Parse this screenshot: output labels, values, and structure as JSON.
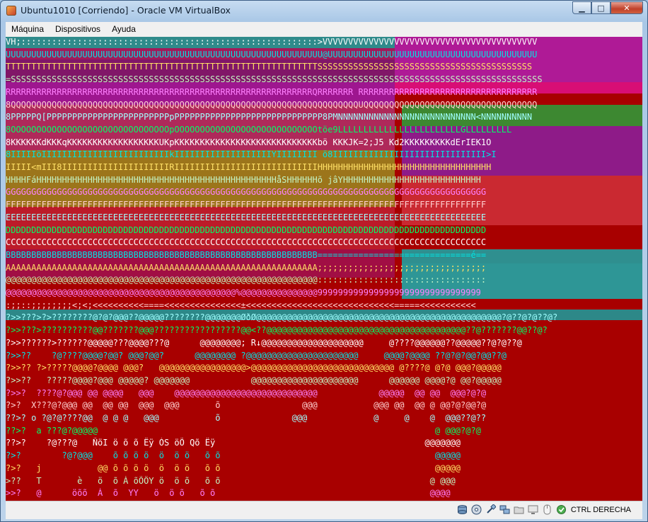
{
  "window": {
    "title": "Ubuntu1010 [Corriendo] - Oracle VM VirtualBox",
    "minimize_glyph": "▁",
    "maximize_glyph": "□",
    "close_glyph": "✕"
  },
  "menu": {
    "items": [
      "Máquina",
      "Dispositivos",
      "Ayuda"
    ]
  },
  "screen": {
    "background": "#a80000",
    "rows": [
      "VH;::::::::::::::::::::::::::::::::::::::::::::::::::::::::::>VVVVVVVVVVVVVVVVVVVVVVVVVVVVVVVVVVVVVVVVVV",
      "UUUUUUUUUUUUUUUUUUUUUUUUUUUUUUUUUUUUUUUUUUUUUUUUUUUUUUUUUUUUUU@UUUUUUUUUUUUUUUUUUUUUUUUUUUUUUUUUUUUUUUUU",
      "TTTTTTTTTTTTTTTTTTTTTTTTTTTTTTTTTTTTTTTTTTTTTTTTTTTTTTTTTTTTTSSSSSSSSSSSSSSSSSSSSSSSSSSSSSSSSSSSSSSSSSS",
      "=SSSSSSSSSSSSSSSSSSSSSSSSSSSSSSSSSSSSSSSSSSSSSSSSSSSSSSSSSSSSSSSSSSSSSSSSSSSSSSSSSSSSSSSSSSSSSSSSSSSSSSSS",
      "RRRRRRRRRRRRRRRRRRRRRRRRRRRRRRRRRRRRRRRRRRRRRRRRRRRRRRRRRRRRQRRRRRRR RRRRRRRRRRRRRRRRRRRRRRRRRRRRRRRRRRR",
      "8QQQQQQQQQQQQQQQQQQQQQQQQQQQQQQQQQQQQQQQQQQQQQQQQQQQQQQQQQQQQQQQQQQQQUQQQQQQQQQQQQQQQQQQQQQQQQQQQQQQQQQQ",
      "8PPPPPQ[PPPPPPPPPPPPPPPPPPPPPPPPpPPPPPPPPPPPPPPPPPPPPPPPPPPPPP8PMNNNNNNNNNNNNNNNNNNNNNNNNNNN<NNNNNNNNNN",
      "8OOOOOOOOOOOOOOOOOOOOOOOOOOOOOOOpOOOOOOOOOOOOOOOOOOOOOOOOOOOOtöe9LLLLLLLLLLLLLLLLLLLLLLLLGLLLLLLLLL",
      "8KKKKKKdKKKqKKKKKKKKKKKKKKKKKKUKpKKKKKKKKKKKKKKKKKKKKKKKKKKKKbö KKKJK=2;J5 Kd2KKKKKKKKKdErIEK1O",
      "8IIIIIöIIIIIIIIIIIIIIIIIIIIIIIIIkIIIIIIIIIIIIIIIIIIIYIIIIIIII ö8IIIIIIIIIIIIIIIIIIIIIIIIIIIIII>I",
      "IIIII<mIII8IIIIIIIIIIIIIIIIIIIIIRIIIIIIIIIIIIIIIIIIIIIIIIIIIIHHHHHHHHHHHHHHHHHHHHHHHHHHHHHHHHHH",
      "HHHHFáHHHHHHHHHHHHHHHHHHHHHHHHHHHHHHHHHHHHHHHHHHHHHHHåSHHHHHHõ jâYHHHHHHHHHHHHHHHHHHHHHHHHHHH",
      "GGGGGGGGGGGGGGGGGGGGGGGGGGGGGGGGGGGGGGGGGGGGGGGGGGGGGGGGGGGGGGGGGGGGGGGGGGGGGGGGGGGGGGGGGGGGGG",
      "FFFFFFFFFFFFFFFFFFFFFFFFFFFFFFFFFFFFFFFFFFFFFFFFFFFFFFFFFFFFFFFFFFFFFFFFFFFFFFFFFFFFFFFFFFFFFF",
      "EEEEEEEEEEEEEEEEEEEEEEEEEEEEEEEEEEEEEEEEEEEEEEEEEEEEEEEEEEEEEEEEEEEEEEEEEEEEEEEEEEEEEEEEEEEEEE",
      "DDDDDDDDDDDDDDDDDDDDDDDDDDDDDDDDDDDDDDDDDDDDDDDDDDDDDDDDDDDDDDDDDDDDDDDDDDDDDDDDDDDDDDDDDDDDDD",
      "CCCCCCCCCCCCCCCCCCCCCCCCCCCCCCCCCCCCCCCCCCCCCCCCCCCCCCCCCCCCCCCCCCCCCCCCCCCCCCCCCCCCCCCCCCCCCC",
      "BBBBBBBBBBBBBBBBBBBBBBBBBBBBBBBBBBBBBBBBBBBBBBBBBBBBBBBBBBBBB==============================é==",
      "AAAAAAAAAAAAAAAAAAAAAAAAAAAAAAAAAAAAAAAAAAAAAAAAAAAAAAAAAAAAA;;;;;;;;;;;;;;;;;;;;;;;;;;;;;;;;;",
      "@@@@@@@@@@@@@@@@@@@@@@@@@@@@@@@@@@@@@@@@@@@@@@@@@@@@@@@@@@@@@:::::::::::::::::::::::::::::::::",
      "@@@@@@@@@@@@@@@@@@@@@@@@@@@@@@@@@@@@@@@@@@@@@%@@@@@@@@@@@@@@@99999999999999999999999999999999",
      ":;;::;;;;;;;;<;<;<<<<<<<<<<====<<<<<<<<<<<<<<<±<<<<<<<<<<<<<<<<<<<<<<<<<<<<<=====<<<<<<<<<<<",
      "?>>???>?>????????@?@?@@@??@@@@@????????@@@@@@@ØðØ@@@@@@@@@@@@@@@@@@@@@@@@@@@@@@@@@@@@@@@@@@@@@@@@?@??@?@??@?",
      "?>>???>??????????@@???????@@@?????????????????@@<??@@@@@@@@@@@@@@@@@@@@@@@@@@@@@@@@@@@@@@@??@???????@@??@?",
      "?>>??????>??????@@@@@???@@@@???@      @@@@@@@@; R↓@@@@@@@@@@@@@@@@@@@@     @????@@@@@@??@@@@@??@?@??@",
      "?>>??    ?@????@@@@?@@? @@@?@@?      @@@@@@@@ ?@@@@@@@@@@@@@@@@@@@@@@     @@@@?@@@@ ??@?@?@@?@@??@",
      "?>>?? ?>?????@@@@?@@@@ @@@?   @@@@@@@@@@@@@@@@@>@@@@@@@@@@@@@@@@@@@@@@@@@@@@ @????@ @?@ @@@?@@@@@",
      "?>>??   ?????@@@@?@@@ @@@@@? @@@@@@@            @@@@@@@@@@@@@@@@@@@@@      @@@@@@ @@@@?@ @@?@@@@@",
      "?>>?  ????@?@@@ @@ @@@@   @@@    @@@@@@@@@@@@@@@@@@@@@@@@@@@@            @@@@@  @@ @@  @@@?@?@",
      "?>?  X???@?@@@ @@  @@ @@  @@@  @@@       õ                @@@           @@@ @@  @@ @ @@?@?@@?@",
      "??>? o ?@?@????@@  @ @ @   @@@           õ              @@@             @     @    @  @@@??@??",
      "??>?  a ???@?@@@@@                                                                  @ @@@?@?@",
      "??>?    ?@???@   ÑöI ö õ õ Ëÿ ÒS öÕ Qõ Ëÿ                                         @@@@@@@",
      "?>?        ?@?@@@    õ õ ö ö  ö  ö ö   õ õ                                          @@@@@",
      "?>?   j           @@ õ õ ö ö  ö  ö ö   õ õ                                          @@@@@",
      ">??   T       è   ö  õ Á õÕÖY ö  ö õ   õ õ                                         @ @@@",
      ">>?   @      öõõ  Á  õ  YY   ö  ö õ   õ õ                                          @@@@"
    ]
  },
  "statusbar": {
    "icons": [
      "hard-disk-icon",
      "optical-drive-icon",
      "usb-icon",
      "network-icon",
      "shared-folders-icon",
      "display-icon",
      "mouse-integration-icon"
    ],
    "host_key": "CTRL DERECHA"
  }
}
